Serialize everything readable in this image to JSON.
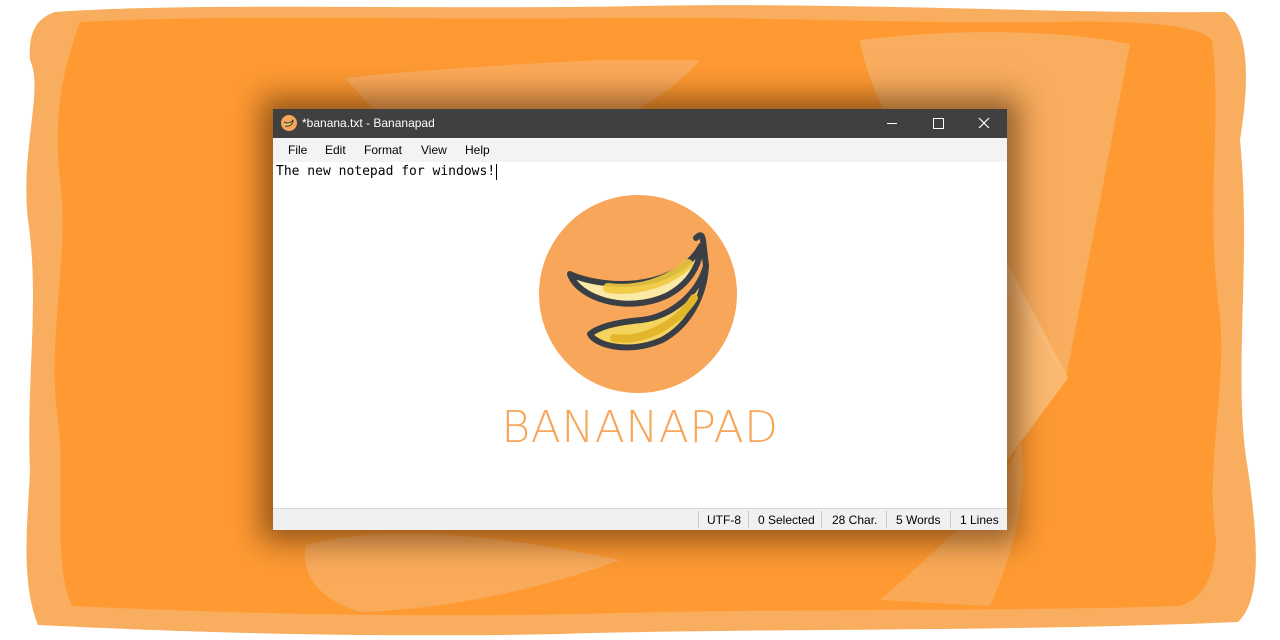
{
  "window": {
    "title": "*banana.txt - Bananapad",
    "app_icon": "banana-app-icon"
  },
  "window_controls": {
    "minimize_icon": "minimize-icon",
    "maximize_icon": "maximize-icon",
    "close_icon": "close-icon"
  },
  "menu": {
    "items": [
      "File",
      "Edit",
      "Format",
      "View",
      "Help"
    ]
  },
  "editor": {
    "content": "The new notepad for windows!"
  },
  "logo": {
    "wordmark": "BANANAPAD",
    "icon": "banana-logo-icon",
    "color": "#f7a65a"
  },
  "statusbar": {
    "encoding": "UTF-8",
    "selected": "0 Selected",
    "chars": "28 Char.",
    "words": "5 Words",
    "lines": "1 Lines"
  },
  "colors": {
    "titlebar": "#404040",
    "backdrop_orange": "#ff9933",
    "backdrop_light_orange": "#f9ad5e",
    "accent": "#f7a65a"
  }
}
